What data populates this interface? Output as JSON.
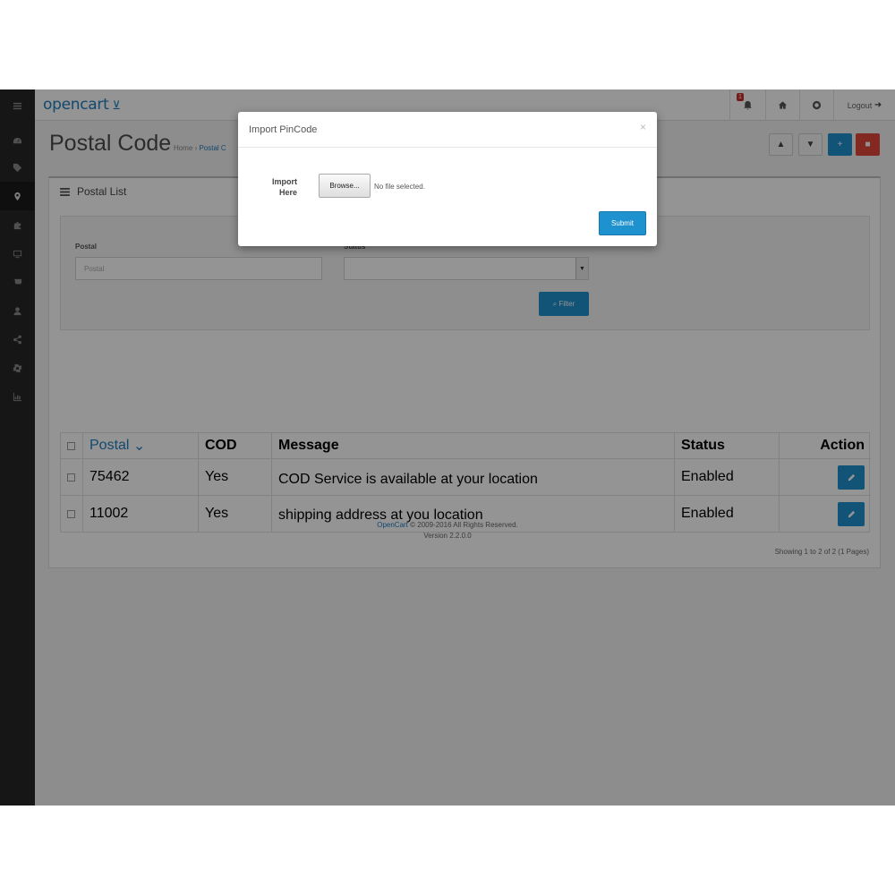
{
  "header": {
    "logo": "opencart",
    "notification_count": "1",
    "logout_label": "Logout"
  },
  "sidebar": {
    "items": [
      {
        "icon": "menu-toggle-icon"
      },
      {
        "icon": "dashboard-icon"
      },
      {
        "icon": "tag-icon"
      },
      {
        "icon": "map-marker-icon",
        "active": true
      },
      {
        "icon": "puzzle-icon"
      },
      {
        "icon": "desktop-icon"
      },
      {
        "icon": "shopping-cart-icon"
      },
      {
        "icon": "user-icon"
      },
      {
        "icon": "share-icon"
      },
      {
        "icon": "cog-icon"
      },
      {
        "icon": "bar-chart-icon"
      }
    ]
  },
  "page": {
    "title": "Postal Code",
    "breadcrumb": [
      "Home",
      "Postal C"
    ]
  },
  "panel": {
    "heading": "Postal List"
  },
  "filter": {
    "postal_label": "Postal",
    "postal_placeholder": "Postal",
    "status_label": "Status",
    "status_value": "",
    "filter_button": "Filter"
  },
  "table": {
    "columns": [
      "Postal",
      "COD",
      "Message",
      "Status",
      "Action"
    ],
    "rows": [
      {
        "postal": "75462",
        "cod": "Yes",
        "message": "COD Service is available at your location",
        "status": "Enabled"
      },
      {
        "postal": "11002",
        "cod": "Yes",
        "message": "shipping address at you location",
        "status": "Enabled"
      }
    ]
  },
  "pagination_text": "Showing 1 to 2 of 2 (1 Pages)",
  "footer": {
    "link": "OpenCart",
    "copyright": "© 2009-2016 All Rights Reserved.",
    "version": "Version 2.2.0.0"
  },
  "modal": {
    "title": "Import PinCode",
    "close": "×",
    "import_label_line1": "Import",
    "import_label_line2": "Here",
    "browse_button": "Browse...",
    "file_status": "No file selected.",
    "submit_button": "Submit"
  },
  "colors": {
    "primary": "#1e91cf",
    "danger": "#e0493b",
    "sidebar": "#262626"
  }
}
